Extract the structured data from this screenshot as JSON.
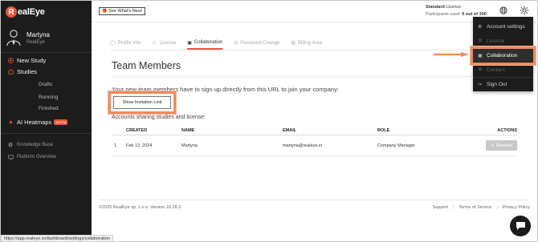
{
  "brand": {
    "logo_letter": "R",
    "logo_text": "ealEye",
    "accent": "#e8573d"
  },
  "user": {
    "name": "Martyna",
    "company": "RealEye"
  },
  "sidebar": {
    "items": [
      {
        "label": "New Study",
        "icon": "plus-circle-icon"
      },
      {
        "label": "Studies",
        "icon": "studies-icon"
      },
      {
        "label": "Drafts"
      },
      {
        "label": "Running"
      },
      {
        "label": "Finished"
      },
      {
        "label": "AI Heatmaps",
        "icon": "heatmap-icon",
        "badge": "ALPHA"
      },
      {
        "label": "Knowledge Base",
        "icon": "gear-icon"
      },
      {
        "label": "Platform Overview",
        "icon": "monitor-icon"
      }
    ]
  },
  "topbar": {
    "whats_new": "See What's New!",
    "license_plan": "Standard",
    "license_word": "Licence",
    "participants_label": "Participants used:",
    "participants_value": "0 out of 300"
  },
  "tabs": [
    {
      "label": "Profile Info",
      "icon": "user-icon"
    },
    {
      "label": "License",
      "icon": "license-icon"
    },
    {
      "label": "Collaboration",
      "icon": "briefcase-icon",
      "active": true
    },
    {
      "label": "Password Change",
      "icon": "lock-icon"
    },
    {
      "label": "Billing Area",
      "icon": "billing-icon"
    }
  ],
  "main": {
    "title": "Team Members",
    "description": "Your new team members have to sign up directly from this URL to join your company:",
    "invite_button": "Show Invitation Link",
    "accounts_label": "Accounts sharing studies and license:"
  },
  "table": {
    "headers": [
      "",
      "CREATED",
      "NAME",
      "EMAIL",
      "ROLE",
      "ACTIONS"
    ],
    "rows": [
      {
        "index": "1",
        "created": "Feb 12, 2024",
        "name": "Martyna",
        "email": "martyna@realeye.io",
        "role": "Company Manager",
        "action": "Remove"
      }
    ]
  },
  "footer": {
    "copyright": "©2025 RealEye sp. z o.o. Version 18.28.2.",
    "links": [
      "Support",
      "Terms of Service",
      "Privacy Policy"
    ]
  },
  "dropdown": {
    "items": [
      {
        "label": "Account settings",
        "icon": "gear-icon"
      },
      {
        "label": "License",
        "icon": "license-icon"
      },
      {
        "label": "Collaboration",
        "icon": "briefcase-icon",
        "active": true
      },
      {
        "label": "Contact",
        "icon": "contact-icon"
      },
      {
        "label": "Sign Out",
        "icon": "sign-out-icon"
      }
    ]
  },
  "status_url": "https://app.realeye.io/dashboard/settings/collaboration",
  "colors": {
    "sidebar_bg": "#1c1c1c",
    "highlight": "#f28a5b",
    "remove_bg": "#c8c8c8"
  }
}
